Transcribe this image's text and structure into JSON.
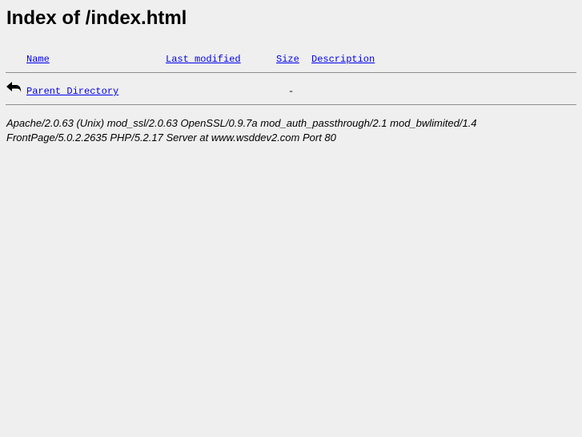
{
  "page": {
    "title": "Index of /index.html"
  },
  "table": {
    "columns": {
      "name": "Name",
      "last_modified": "Last modified",
      "size": "Size",
      "description": "Description"
    },
    "rows": [
      {
        "icon": "back-arrow-icon",
        "name": "Parent Directory",
        "last_modified": "",
        "size": "-",
        "description": ""
      }
    ]
  },
  "footer": {
    "line1": "Apache/2.0.63 (Unix) mod_ssl/2.0.63 OpenSSL/0.9.7a mod_auth_passthrough/2.1 mod_bwlimited/1.4",
    "line2": "FrontPage/5.0.2.2635 PHP/5.2.17 Server at www.wsddev2.com Port 80"
  }
}
